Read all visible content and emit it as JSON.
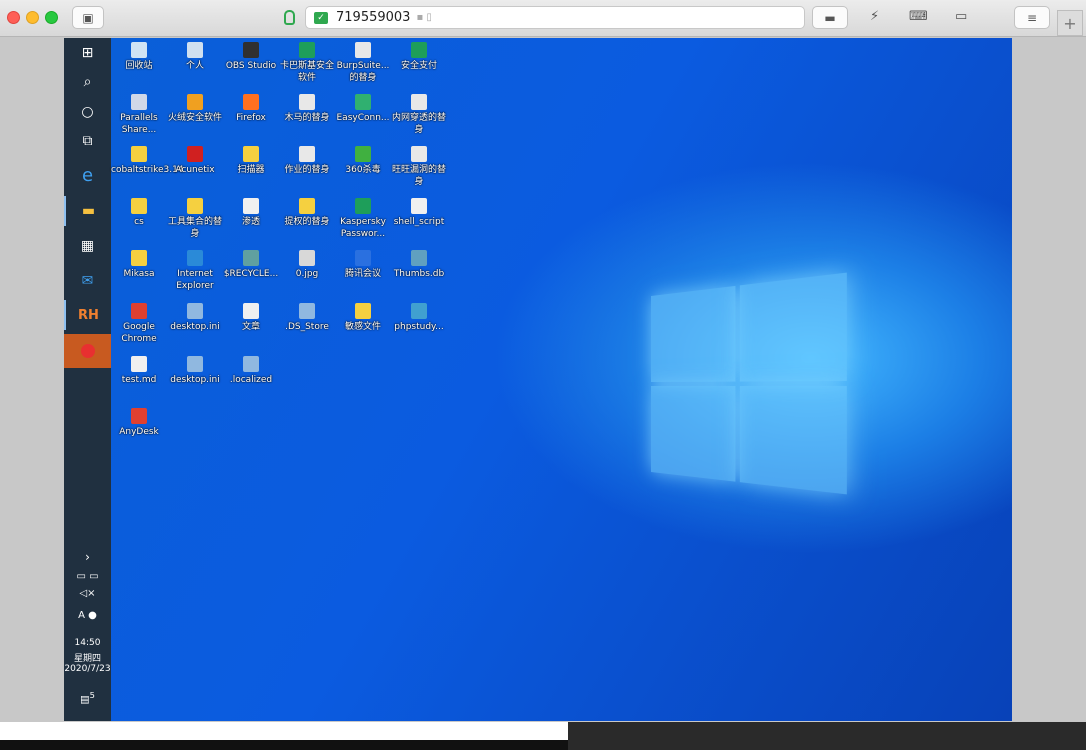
{
  "window": {
    "address": "719559003"
  },
  "taskbar": {
    "time": "14:50",
    "weekday": "星期四",
    "date": "2020/7/23",
    "notification_count": "5",
    "ime": "A",
    "rh_label": "RH"
  },
  "desktop_icons": [
    {
      "label": "回收站",
      "col": 0,
      "row": 0,
      "color": "#d0e4f4"
    },
    {
      "label": "个人",
      "col": 1,
      "row": 0,
      "color": "#cfe0f0"
    },
    {
      "label": "OBS Studio",
      "col": 2,
      "row": 0,
      "color": "#303030"
    },
    {
      "label": "卡巴斯基安全软件",
      "col": 3,
      "row": 0,
      "color": "#1e9e5a"
    },
    {
      "label": "BurpSuite...的替身",
      "col": 4,
      "row": 0,
      "color": "#e8e8e8"
    },
    {
      "label": "安全支付",
      "col": 5,
      "row": 0,
      "color": "#1e9e5a"
    },
    {
      "label": "Parallels Share...",
      "col": 0,
      "row": 1,
      "color": "#d0d8e8"
    },
    {
      "label": "火绒安全软件",
      "col": 1,
      "row": 1,
      "color": "#f0a020"
    },
    {
      "label": "Firefox",
      "col": 2,
      "row": 1,
      "color": "#ff7020"
    },
    {
      "label": "木马的替身",
      "col": 3,
      "row": 1,
      "color": "#e8e8e8"
    },
    {
      "label": "EasyConn...",
      "col": 4,
      "row": 1,
      "color": "#30b070"
    },
    {
      "label": "内网穿透的替身",
      "col": 5,
      "row": 1,
      "color": "#e8e8e8"
    },
    {
      "label": "cobaltstrike3.14",
      "col": 0,
      "row": 2,
      "color": "#f5d040"
    },
    {
      "label": "Acunetix",
      "col": 1,
      "row": 2,
      "color": "#d02020"
    },
    {
      "label": "扫描器",
      "col": 2,
      "row": 2,
      "color": "#f5d040"
    },
    {
      "label": "作业的替身",
      "col": 3,
      "row": 2,
      "color": "#e8e8e8"
    },
    {
      "label": "360杀毒",
      "col": 4,
      "row": 2,
      "color": "#40b040"
    },
    {
      "label": "旺旺漏洞的替身",
      "col": 5,
      "row": 2,
      "color": "#e8e8e8"
    },
    {
      "label": "cs",
      "col": 0,
      "row": 3,
      "color": "#f5d040"
    },
    {
      "label": "工具集合的替身",
      "col": 1,
      "row": 3,
      "color": "#f5d040"
    },
    {
      "label": "渗透",
      "col": 2,
      "row": 3,
      "color": "#f0f0f0"
    },
    {
      "label": "提权的替身",
      "col": 3,
      "row": 3,
      "color": "#f5d040"
    },
    {
      "label": "Kaspersky Passwor...",
      "col": 4,
      "row": 3,
      "color": "#1e9e5a"
    },
    {
      "label": "shell_script",
      "col": 5,
      "row": 3,
      "color": "#f0f0f0"
    },
    {
      "label": "Mikasa",
      "col": 0,
      "row": 4,
      "color": "#f5d040"
    },
    {
      "label": "Internet Explorer",
      "col": 1,
      "row": 4,
      "color": "#2a8ad8"
    },
    {
      "label": "$RECYCLE...",
      "col": 2,
      "row": 4,
      "color": "#60a0a0"
    },
    {
      "label": "0.jpg",
      "col": 3,
      "row": 4,
      "color": "#d8d8d8"
    },
    {
      "label": "腾讯会议",
      "col": 4,
      "row": 4,
      "color": "#2a70e0"
    },
    {
      "label": "Thumbs.db",
      "col": 5,
      "row": 4,
      "color": "#60a0c0"
    },
    {
      "label": "Google Chrome",
      "col": 0,
      "row": 5,
      "color": "#e04030"
    },
    {
      "label": "desktop.ini",
      "col": 1,
      "row": 5,
      "color": "#90b8e0"
    },
    {
      "label": "文章",
      "col": 2,
      "row": 5,
      "color": "#f0f0f0"
    },
    {
      "label": ".DS_Store",
      "col": 3,
      "row": 5,
      "color": "#90b8e0"
    },
    {
      "label": "敏感文件",
      "col": 4,
      "row": 5,
      "color": "#f5d040"
    },
    {
      "label": "phpstudy...",
      "col": 5,
      "row": 5,
      "color": "#40a0d0"
    },
    {
      "label": "test.md",
      "col": 0,
      "row": 6,
      "color": "#f0f0f0"
    },
    {
      "label": "desktop.ini",
      "col": 1,
      "row": 6,
      "color": "#90b8e0"
    },
    {
      "label": ".localized",
      "col": 2,
      "row": 6,
      "color": "#90b8e0"
    },
    {
      "label": "AnyDesk",
      "col": 0,
      "row": 7,
      "color": "#e04030"
    }
  ]
}
